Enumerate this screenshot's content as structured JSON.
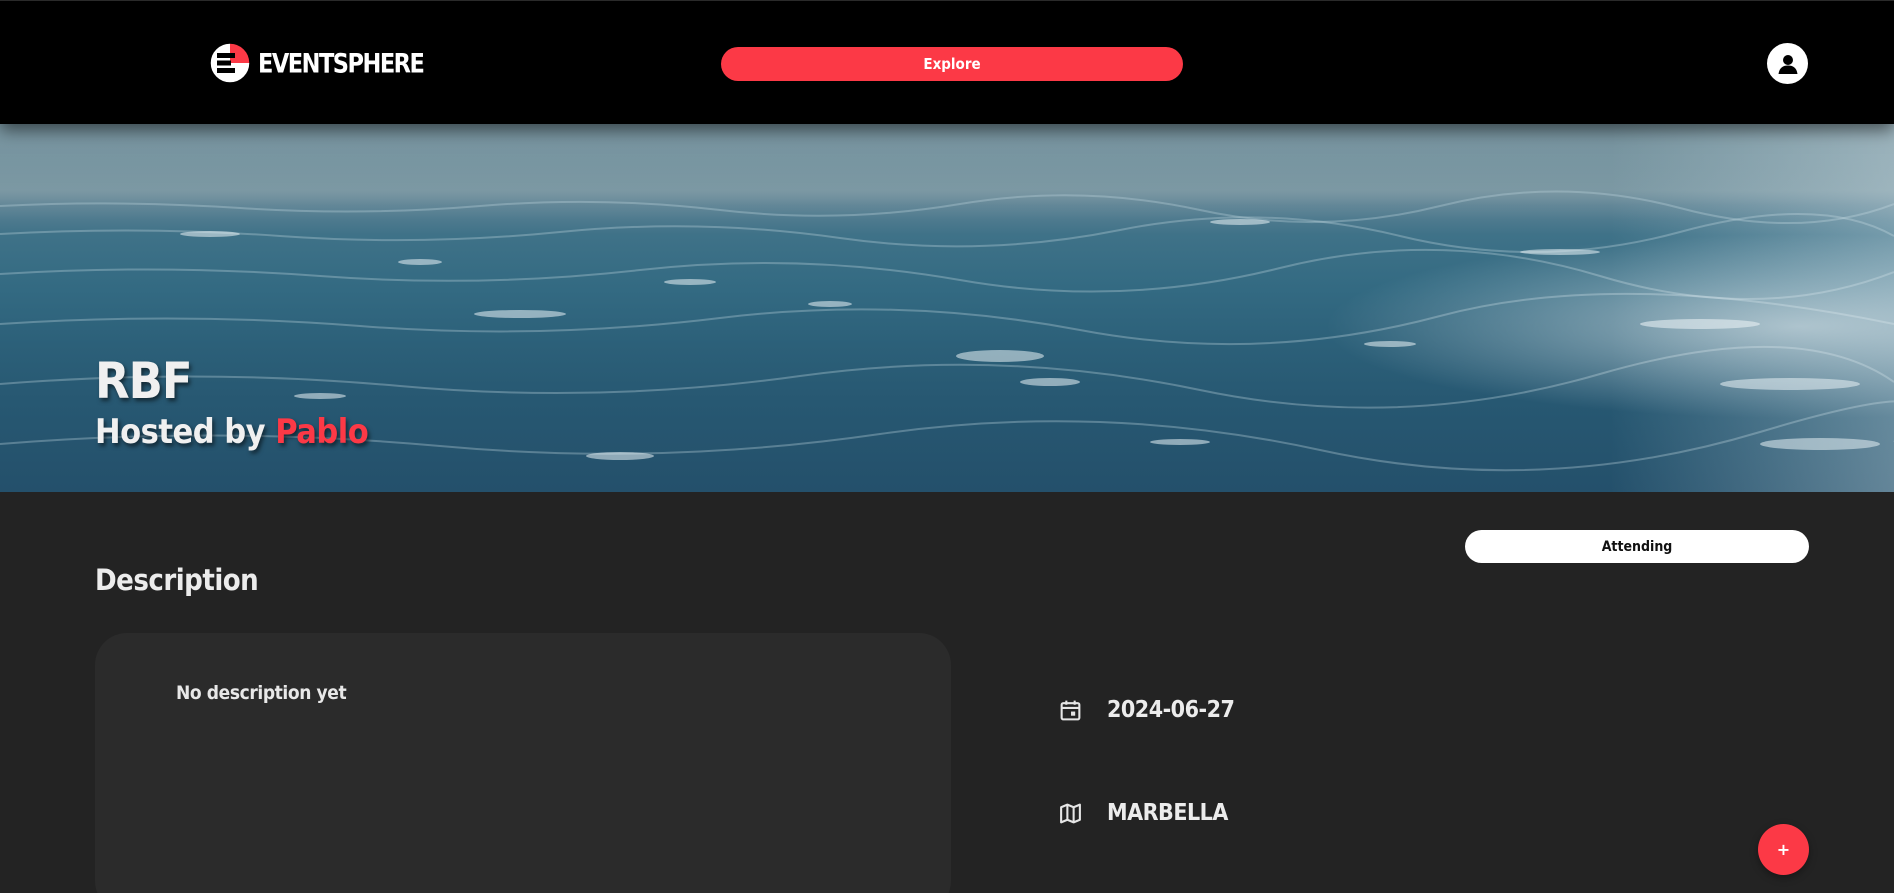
{
  "brand": {
    "name": "EVENTSPHERE",
    "accent_color": "#fc3946"
  },
  "nav": {
    "explore_label": "Explore",
    "avatar_icon": "user-avatar-icon"
  },
  "event": {
    "title": "RBF",
    "hosted_by_prefix": "Hosted by",
    "host_name": "Pablo",
    "cover_image": "ocean-waves-photo",
    "attendance_label": "Attending",
    "description_heading": "Description",
    "description": "No description yet",
    "date": "2024-06-27",
    "date_icon": "calendar-icon",
    "location": "MARBELLA",
    "location_icon": "map-icon"
  },
  "fab": {
    "label": "+"
  }
}
